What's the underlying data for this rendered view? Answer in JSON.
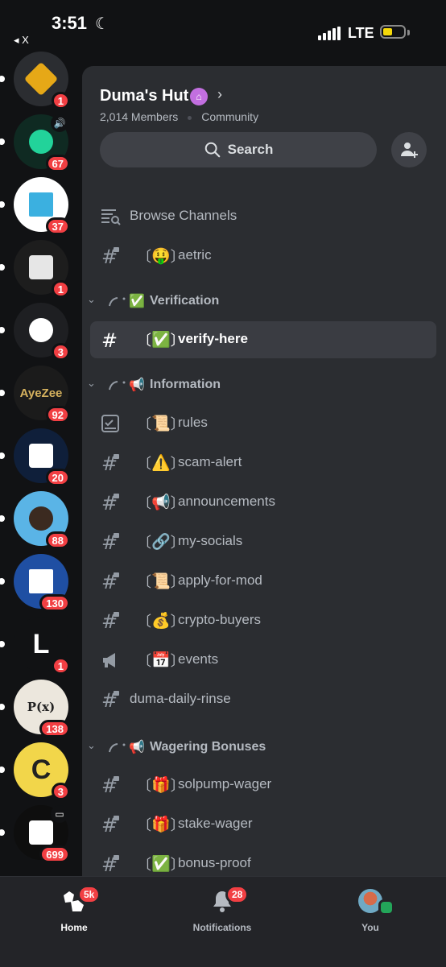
{
  "status_bar": {
    "time": "3:51",
    "back_label": "◂ X",
    "network": "LTE"
  },
  "servers": [
    {
      "name": "Server with orange diamond icon",
      "badge": "1",
      "bg": "#2b2d31",
      "accent": "#e6a817"
    },
    {
      "name": "Pi server",
      "badge": "67",
      "bg": "#0f2a22",
      "accent": "#22d39a",
      "voice": true
    },
    {
      "name": "Blue cube server",
      "badge": "37",
      "bg": "#ffffff",
      "accent": "#3bb0e0"
    },
    {
      "name": "Avatar server",
      "badge": "1",
      "bg": "#1d1d1d",
      "accent": "#e6e6e6"
    },
    {
      "name": "Pixel castle server",
      "badge": "3",
      "bg": "#1e1f22",
      "accent": "#ffffff"
    },
    {
      "name": "AyeZee server",
      "badge": "92",
      "bg": "#1b1b1b",
      "accent": "#d6b25e",
      "text": "AyeZee"
    },
    {
      "name": "T logo server",
      "badge": "20",
      "bg": "#0f1f3a",
      "accent": "#ffffff"
    },
    {
      "name": "Character server",
      "badge": "88",
      "bg": "#5ab4e6",
      "accent": "#3b2a20"
    },
    {
      "name": "Blue ring server",
      "badge": "130",
      "bg": "#1f4fa3",
      "accent": "#ffffff"
    },
    {
      "name": "L logo server",
      "badge": "1",
      "bg": "#111214",
      "accent": "#ffffff",
      "text": "L"
    },
    {
      "name": "P(x) server",
      "badge": "138",
      "bg": "#ece7dd",
      "accent": "#222222",
      "text": "P(x)"
    },
    {
      "name": "C server",
      "badge": "3",
      "bg": "#f2d64a",
      "accent": "#222222",
      "text": "C"
    },
    {
      "name": "Knot server",
      "badge": "699",
      "bg": "#0e0e0e",
      "accent": "#ffffff",
      "screen": true
    }
  ],
  "server_header": {
    "name": "Duma's Hut",
    "members": "2,014 Members",
    "community": "Community",
    "search_label": "Search"
  },
  "channels": {
    "browse": {
      "label": "Browse Channels"
    },
    "aetric": {
      "emoji": "🤑",
      "name": "aetric"
    },
    "cat_verification": {
      "emoji": "✅",
      "label": "Verification"
    },
    "verify_here": {
      "emoji": "✅",
      "name": "verify-here"
    },
    "cat_information": {
      "emoji": "📢",
      "label": "Information"
    },
    "rules": {
      "emoji": "📜",
      "name": "rules"
    },
    "scam_alert": {
      "emoji": "⚠️",
      "name": "scam-alert"
    },
    "announcements": {
      "emoji": "📢",
      "name": "announcements"
    },
    "my_socials": {
      "emoji": "🔗",
      "name": "my-socials"
    },
    "apply_for_mod": {
      "emoji": "📜",
      "name": "apply-for-mod"
    },
    "crypto_buyers": {
      "emoji": "💰",
      "name": "crypto-buyers"
    },
    "events": {
      "emoji": "📅",
      "name": "events"
    },
    "duma_daily_rinse": {
      "name": "duma-daily-rinse"
    },
    "cat_wagering": {
      "emoji": "📢",
      "label": "Wagering Bonuses"
    },
    "solpump_wager": {
      "emoji": "🎁",
      "name": "solpump-wager"
    },
    "stake_wager": {
      "emoji": "🎁",
      "name": "stake-wager"
    },
    "bonus_proof": {
      "emoji": "✅",
      "name": "bonus-proof"
    }
  },
  "bottom_nav": {
    "home": {
      "label": "Home",
      "badge": "5k"
    },
    "notifications": {
      "label": "Notifications",
      "badge": "28"
    },
    "you": {
      "label": "You"
    }
  },
  "colors": {
    "badge_red": "#f23f43",
    "online_green": "#23a559",
    "panel": "#2b2d31",
    "rail": "#111214"
  }
}
